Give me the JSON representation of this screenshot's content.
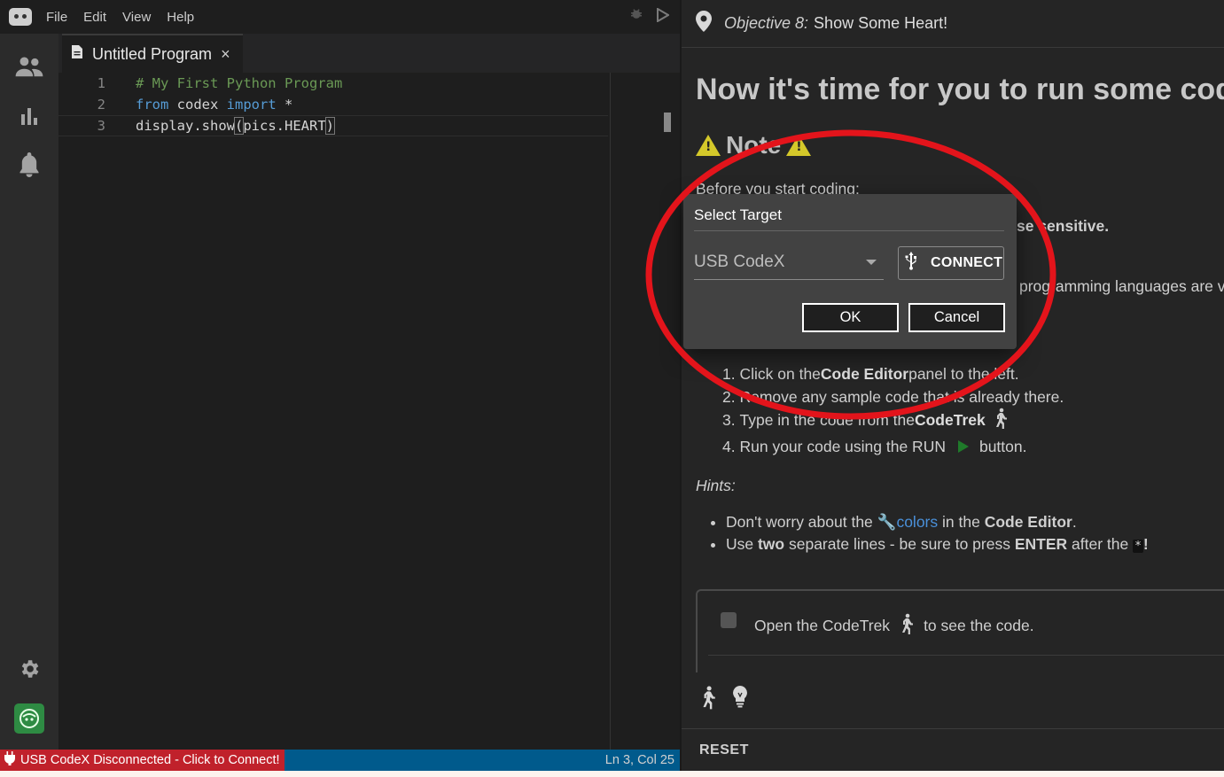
{
  "menu": {
    "file": "File",
    "edit": "Edit",
    "view": "View",
    "help": "Help"
  },
  "editor": {
    "tab_title": "Untitled Program",
    "tab_close": "×",
    "lines": [
      {
        "num": "1",
        "comment": "# My First Python Program"
      },
      {
        "num": "2",
        "kw1": "from",
        "mid": " codex ",
        "kw2": "import",
        "rest": " *"
      },
      {
        "num": "3",
        "p1": "display.show",
        "p2": "(",
        "p3": "pics.HEART",
        "p4": ")"
      }
    ]
  },
  "status": {
    "connection": "USB CodeX Disconnected - Click to Connect!",
    "position": "Ln 3, Col 25"
  },
  "objective": {
    "label": "Objective 8:",
    "title": "Show Some Heart!"
  },
  "content": {
    "heading": "Now it's time for you to run some code",
    "note_title": "Note",
    "before": "Before you start coding:",
    "case_tail": "se sensitive.",
    "prog_tail": "programming languages are v",
    "steps": [
      {
        "n": "1.",
        "a": "Click on the ",
        "b": "Code Editor",
        "c": " panel to the left."
      },
      {
        "n": "2.",
        "a": "Remove any sample code that is already there."
      },
      {
        "n": "3.",
        "a": "Type in the code from the ",
        "b": "CodeTrek"
      },
      {
        "n": "4.",
        "a": "Run your code using the RUN",
        "c": "button."
      }
    ],
    "hints_label": "Hints:",
    "hints": [
      {
        "a": "Don't worry about the ",
        "link": "colors",
        "b": " in the ",
        "c": "Code Editor",
        "d": "."
      },
      {
        "a": "Use ",
        "b": "two",
        "c": " separate lines - be sure to press ",
        "d": "ENTER",
        "e": " after the ",
        "star": "*",
        "f": "!"
      }
    ],
    "trek_a": "Open the CodeTrek",
    "trek_b": "to see the code."
  },
  "reset_label": "RESET",
  "dialog": {
    "title": "Select Target",
    "selected": "USB CodeX",
    "connect": "CONNECT",
    "ok": "OK",
    "cancel": "Cancel"
  },
  "colors": {
    "status_error": "#c0212b",
    "status_bar": "#005a8c",
    "annotation": "#e3141b",
    "brand": "#2e8b43"
  }
}
